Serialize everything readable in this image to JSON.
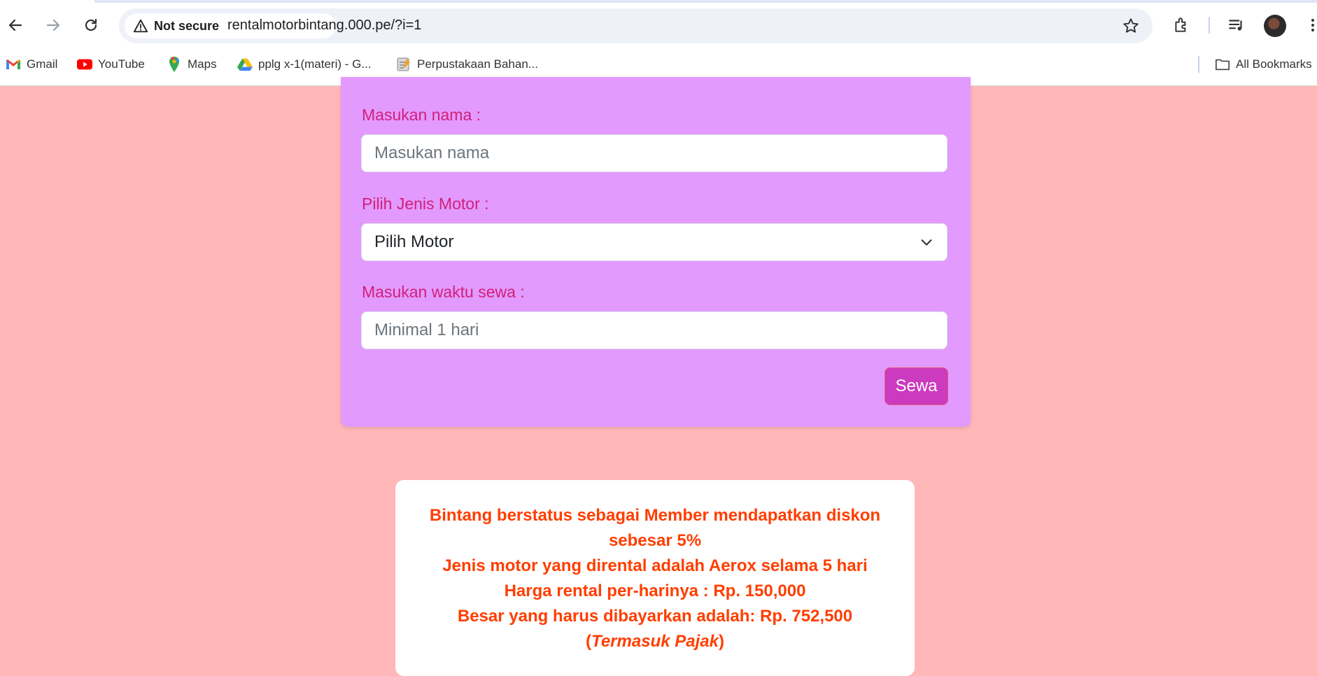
{
  "browser": {
    "security_label": "Not secure",
    "url": "rentalmotorbintang.000.pe/?i=1",
    "bookmarks": [
      {
        "label": "Gmail",
        "icon": "gmail-icon"
      },
      {
        "label": "YouTube",
        "icon": "youtube-icon"
      },
      {
        "label": "Maps",
        "icon": "maps-icon"
      },
      {
        "label": "pplg x-1(materi) - G...",
        "icon": "google-drive-icon"
      },
      {
        "label": "Perpustakaan Bahan...",
        "icon": "note-icon"
      }
    ],
    "all_bookmarks": "All Bookmarks"
  },
  "form": {
    "name_label": "Masukan nama :",
    "name_placeholder": "Masukan nama",
    "motor_label": "Pilih Jenis Motor :",
    "motor_selected": "Pilih Motor",
    "duration_label": "Masukan waktu sewa :",
    "duration_placeholder": "Minimal 1 hari",
    "submit_label": "Sewa"
  },
  "result": {
    "line1": "Bintang berstatus sebagai Member mendapatkan diskon sebesar 5%",
    "line2": "Jenis motor yang dirental adalah Aerox selama 5 hari",
    "line3": "Harga rental per-harinya : Rp. 150,000",
    "line4": "Besar yang harus dibayarkan adalah: Rp. 752,500",
    "line5_open": "(",
    "line5_em": "Termasuk Pajak",
    "line5_close": ")"
  },
  "colors": {
    "page_bg": "#ffb7b7",
    "form_bg": "#e29afe",
    "label": "#d31f7a",
    "button": "#cc3abf",
    "result_text": "#ff3e00"
  }
}
